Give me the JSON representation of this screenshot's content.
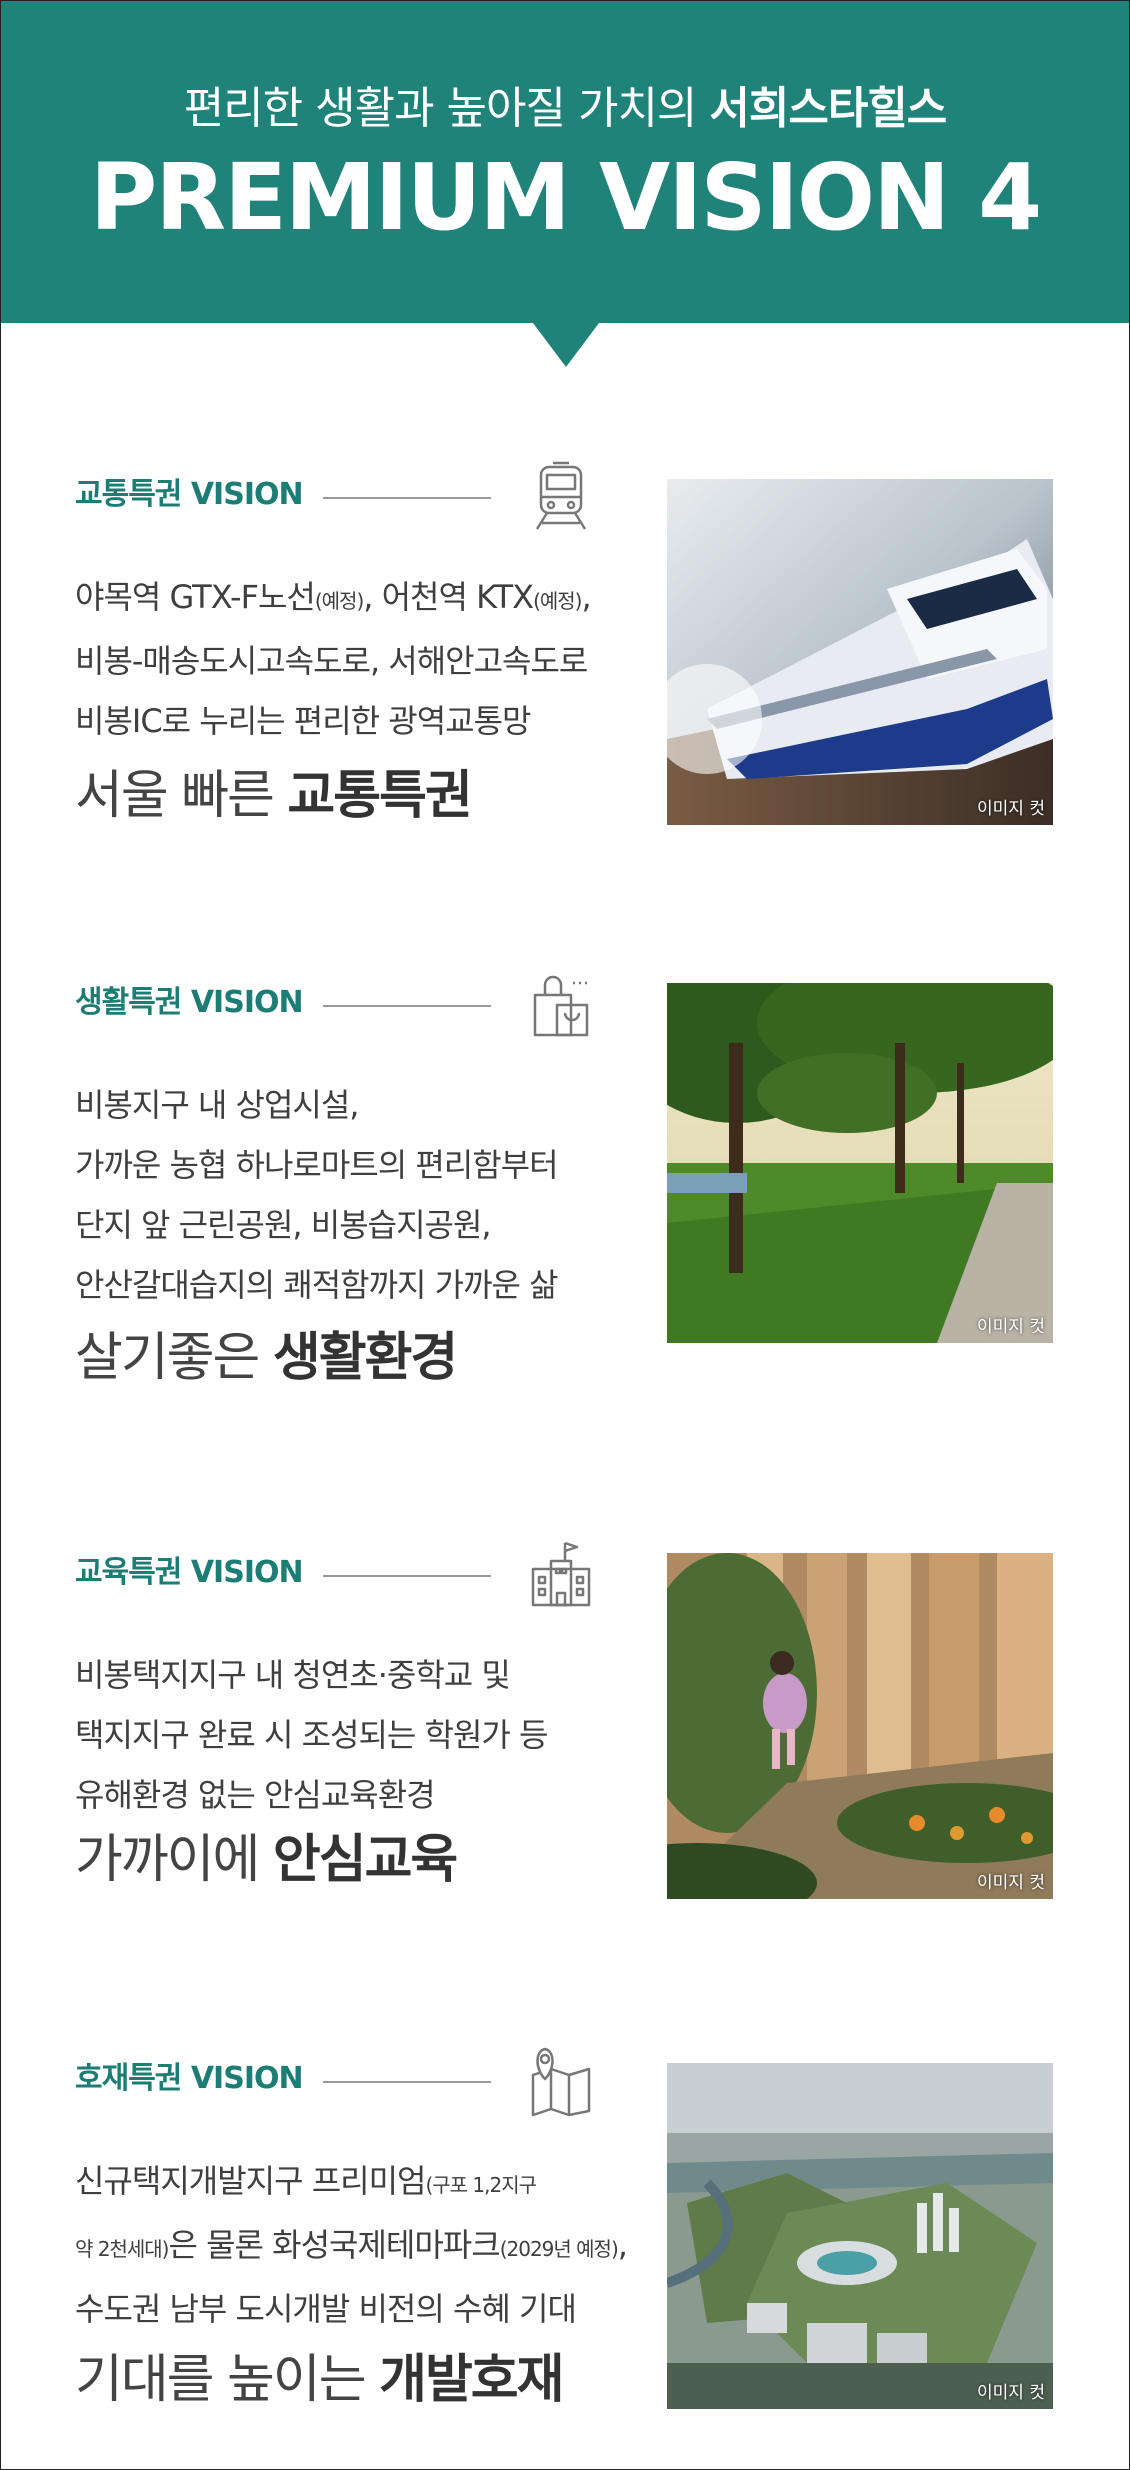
{
  "header": {
    "subtitle_normal": "편리한 생활과 높아질 가치의 ",
    "subtitle_bold": "서희스타힐스",
    "title": "PREMIUM VISION 4"
  },
  "image_caption": "이미지 컷",
  "visions": [
    {
      "label": "교통특권 VISION",
      "icon": "train-icon",
      "lines": [
        [
          "야목역 GTX-F노선",
          "(예정)",
          ", 어천역 KTX",
          "(예정)",
          ","
        ],
        [
          "비봉-매송도시고속도로, 서해안고속도로"
        ],
        [
          "비봉IC로 누리는 편리한 광역교통망"
        ]
      ],
      "headline_normal": "서울 빠른 ",
      "headline_bold": "교통특권"
    },
    {
      "label": "생활특권 VISION",
      "icon": "shopping-bag-icon",
      "lines": [
        [
          "비봉지구 내 상업시설,"
        ],
        [
          "가까운 농협 하나로마트의 편리함부터"
        ],
        [
          "단지 앞 근린공원, 비봉습지공원,"
        ],
        [
          "안산갈대습지의 쾌적함까지 가까운 삶"
        ]
      ],
      "headline_normal": "살기좋은 ",
      "headline_bold": "생활환경"
    },
    {
      "label": "교육특권 VISION",
      "icon": "school-building-icon",
      "lines": [
        [
          "비봉택지지구 내 청연초·중학교 및"
        ],
        [
          "택지지구 완료 시 조성되는 학원가 등"
        ],
        [
          "유해환경 없는 안심교육환경"
        ]
      ],
      "headline_normal": "가까이에 ",
      "headline_bold": "안심교육"
    },
    {
      "label": "호재특권 VISION",
      "icon": "map-pin-icon",
      "lines": [
        [
          "신규택지개발지구 프리미엄",
          "(구포 1,2지구"
        ],
        [
          "",
          "약 2천세대)",
          "은 물론 화성국제테마파크",
          "(2029년 예정)",
          ","
        ],
        [
          "수도권 남부 도시개발 비전의 수혜 기대"
        ]
      ],
      "headline_normal": "기대를 높이는 ",
      "headline_bold": "개발호재"
    }
  ],
  "colors": {
    "brand_teal": "#1f8379",
    "vision_label": "#1c7d74"
  }
}
